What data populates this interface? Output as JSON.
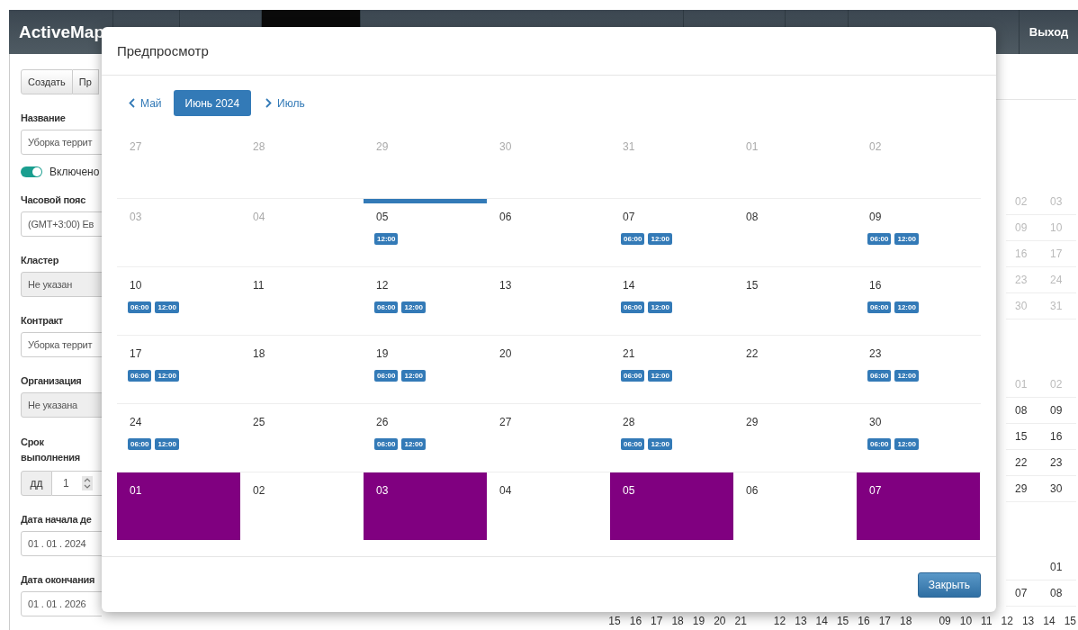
{
  "navbar": {
    "brand": "ActiveMap",
    "exit": "Выход"
  },
  "form": {
    "buttons": [
      "Создать",
      "Пр"
    ],
    "fields": [
      {
        "kind": "input",
        "label": "Название",
        "value": "Уборка террит",
        "disabled": false
      },
      {
        "kind": "toggle",
        "label": "Включено",
        "on": true
      },
      {
        "kind": "input",
        "label": "Часовой пояс",
        "value": "(GMT+3:00) Ев",
        "disabled": false
      },
      {
        "kind": "input",
        "label": "Кластер",
        "value": "Не указан",
        "disabled": true
      },
      {
        "kind": "input",
        "label": "Контракт",
        "value": "Уборка террит",
        "disabled": false
      },
      {
        "kind": "input",
        "label": "Организация",
        "value": "Не указана",
        "disabled": true
      },
      {
        "kind": "duration",
        "label": "Срок выполнения",
        "unit": "дд",
        "value": "1"
      },
      {
        "kind": "input",
        "label": "Дата начала де",
        "value": "01 . 01 . 2024",
        "disabled": false
      },
      {
        "kind": "input",
        "label": "Дата окончания",
        "value": "01 . 01 . 2026",
        "disabled": false
      }
    ]
  },
  "background_calendar": {
    "side_groups": [
      [
        {
          "days": [
            "02",
            "03"
          ],
          "muted": true
        },
        {
          "days": [
            "09",
            "10"
          ],
          "muted": true
        },
        {
          "days": [
            "16",
            "17"
          ],
          "muted": true
        },
        {
          "days": [
            "23",
            "24"
          ],
          "muted": true
        },
        {
          "days": [
            "30",
            "31"
          ],
          "muted": true
        }
      ],
      [
        {
          "days": [
            "01",
            "02"
          ],
          "muted": true
        },
        {
          "days": [
            "08",
            "09"
          ],
          "muted": false
        },
        {
          "days": [
            "15",
            "16"
          ],
          "muted": false
        },
        {
          "days": [
            "22",
            "23"
          ],
          "muted": false
        },
        {
          "days": [
            "29",
            "30"
          ],
          "muted": false
        }
      ],
      [
        {
          "days": [
            "01"
          ],
          "muted": false
        },
        {
          "days": [
            "07",
            "08"
          ],
          "muted": false
        }
      ]
    ],
    "bottom_weeks": [
      [
        "15",
        "16",
        "17",
        "18",
        "19",
        "20",
        "21"
      ],
      [
        "12",
        "13",
        "14",
        "15",
        "16",
        "17",
        "18"
      ],
      [
        "09",
        "10",
        "11",
        "12",
        "13",
        "14",
        "15"
      ]
    ]
  },
  "preview_modal": {
    "title": "Предпросмотр",
    "prev_month": "Май",
    "current_month": "Июнь 2024",
    "next_month": "Июль",
    "weeks": [
      [
        {
          "day": "27",
          "muted": true,
          "today": false,
          "highlighted": false
        },
        {
          "day": "28",
          "muted": true,
          "today": false,
          "highlighted": false
        },
        {
          "day": "29",
          "muted": true,
          "today": false,
          "highlighted": false
        },
        {
          "day": "30",
          "muted": true,
          "today": false,
          "highlighted": false
        },
        {
          "day": "31",
          "muted": true,
          "today": false,
          "highlighted": false
        },
        {
          "day": "01",
          "muted": true,
          "today": false,
          "highlighted": false
        },
        {
          "day": "02",
          "muted": true,
          "today": false,
          "highlighted": false
        }
      ],
      [
        {
          "day": "03",
          "muted": true,
          "today": false,
          "highlighted": false
        },
        {
          "day": "04",
          "muted": true,
          "today": false,
          "highlighted": false
        },
        {
          "day": "05",
          "muted": false,
          "today": true,
          "highlighted": false,
          "times": [
            "12:00"
          ]
        },
        {
          "day": "06",
          "muted": false,
          "today": false,
          "highlighted": false
        },
        {
          "day": "07",
          "muted": false,
          "today": false,
          "highlighted": false,
          "times": [
            "06:00",
            "12:00"
          ]
        },
        {
          "day": "08",
          "muted": false,
          "today": false,
          "highlighted": false
        },
        {
          "day": "09",
          "muted": false,
          "today": false,
          "highlighted": false,
          "times": [
            "06:00",
            "12:00"
          ]
        }
      ],
      [
        {
          "day": "10",
          "muted": false,
          "today": false,
          "highlighted": false,
          "times": [
            "06:00",
            "12:00"
          ]
        },
        {
          "day": "11",
          "muted": false,
          "today": false,
          "highlighted": false
        },
        {
          "day": "12",
          "muted": false,
          "today": false,
          "highlighted": false,
          "times": [
            "06:00",
            "12:00"
          ]
        },
        {
          "day": "13",
          "muted": false,
          "today": false,
          "highlighted": false
        },
        {
          "day": "14",
          "muted": false,
          "today": false,
          "highlighted": false,
          "times": [
            "06:00",
            "12:00"
          ]
        },
        {
          "day": "15",
          "muted": false,
          "today": false,
          "highlighted": false
        },
        {
          "day": "16",
          "muted": false,
          "today": false,
          "highlighted": false,
          "times": [
            "06:00",
            "12:00"
          ]
        }
      ],
      [
        {
          "day": "17",
          "muted": false,
          "today": false,
          "highlighted": false,
          "times": [
            "06:00",
            "12:00"
          ]
        },
        {
          "day": "18",
          "muted": false,
          "today": false,
          "highlighted": false
        },
        {
          "day": "19",
          "muted": false,
          "today": false,
          "highlighted": false,
          "times": [
            "06:00",
            "12:00"
          ]
        },
        {
          "day": "20",
          "muted": false,
          "today": false,
          "highlighted": false
        },
        {
          "day": "21",
          "muted": false,
          "today": false,
          "highlighted": false,
          "times": [
            "06:00",
            "12:00"
          ]
        },
        {
          "day": "22",
          "muted": false,
          "today": false,
          "highlighted": false
        },
        {
          "day": "23",
          "muted": false,
          "today": false,
          "highlighted": false,
          "times": [
            "06:00",
            "12:00"
          ]
        }
      ],
      [
        {
          "day": "24",
          "muted": false,
          "today": false,
          "highlighted": false,
          "times": [
            "06:00",
            "12:00"
          ]
        },
        {
          "day": "25",
          "muted": false,
          "today": false,
          "highlighted": false
        },
        {
          "day": "26",
          "muted": false,
          "today": false,
          "highlighted": false,
          "times": [
            "06:00",
            "12:00"
          ]
        },
        {
          "day": "27",
          "muted": false,
          "today": false,
          "highlighted": false
        },
        {
          "day": "28",
          "muted": false,
          "today": false,
          "highlighted": false,
          "times": [
            "06:00",
            "12:00"
          ]
        },
        {
          "day": "29",
          "muted": false,
          "today": false,
          "highlighted": false
        },
        {
          "day": "30",
          "muted": false,
          "today": false,
          "highlighted": false,
          "times": [
            "06:00",
            "12:00"
          ]
        }
      ],
      [
        {
          "day": "01",
          "muted": false,
          "today": false,
          "highlighted": true
        },
        {
          "day": "02",
          "muted": false,
          "today": false,
          "highlighted": false
        },
        {
          "day": "03",
          "muted": false,
          "today": false,
          "highlighted": true
        },
        {
          "day": "04",
          "muted": false,
          "today": false,
          "highlighted": false
        },
        {
          "day": "05",
          "muted": false,
          "today": false,
          "highlighted": true
        },
        {
          "day": "06",
          "muted": false,
          "today": false,
          "highlighted": false
        },
        {
          "day": "07",
          "muted": false,
          "today": false,
          "highlighted": true
        }
      ]
    ],
    "close_button": "Закрыть"
  }
}
